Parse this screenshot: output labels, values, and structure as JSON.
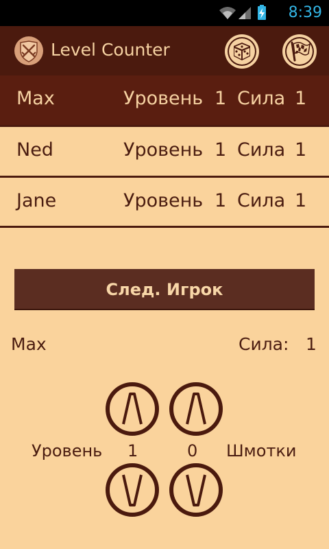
{
  "status_bar": {
    "time": "8:39"
  },
  "app": {
    "title": "Level Counter"
  },
  "actions": {
    "dice_icon": "dice-icon",
    "flag_icon": "checkered-flag-icon"
  },
  "players": [
    {
      "name": "Max",
      "level_label": "Уровень",
      "level": "1",
      "strength_label": "Сила",
      "strength": "1"
    },
    {
      "name": "Ned",
      "level_label": "Уровень",
      "level": "1",
      "strength_label": "Сила",
      "strength": "1"
    },
    {
      "name": "Jane",
      "level_label": "Уровень",
      "level": "1",
      "strength_label": "Сила",
      "strength": "1"
    }
  ],
  "next_button": {
    "label": "След. Игрок"
  },
  "current": {
    "name": "Max",
    "strength_label": "Сила:",
    "strength": "1",
    "level_label": "Уровень",
    "level": "1",
    "gear": "0",
    "gear_label": "Шмотки"
  },
  "colors": {
    "background": "#fad39c",
    "dark_brown": "#4b1a0e",
    "button_brown": "#5b2d21",
    "status_blue": "#33b5e5"
  }
}
